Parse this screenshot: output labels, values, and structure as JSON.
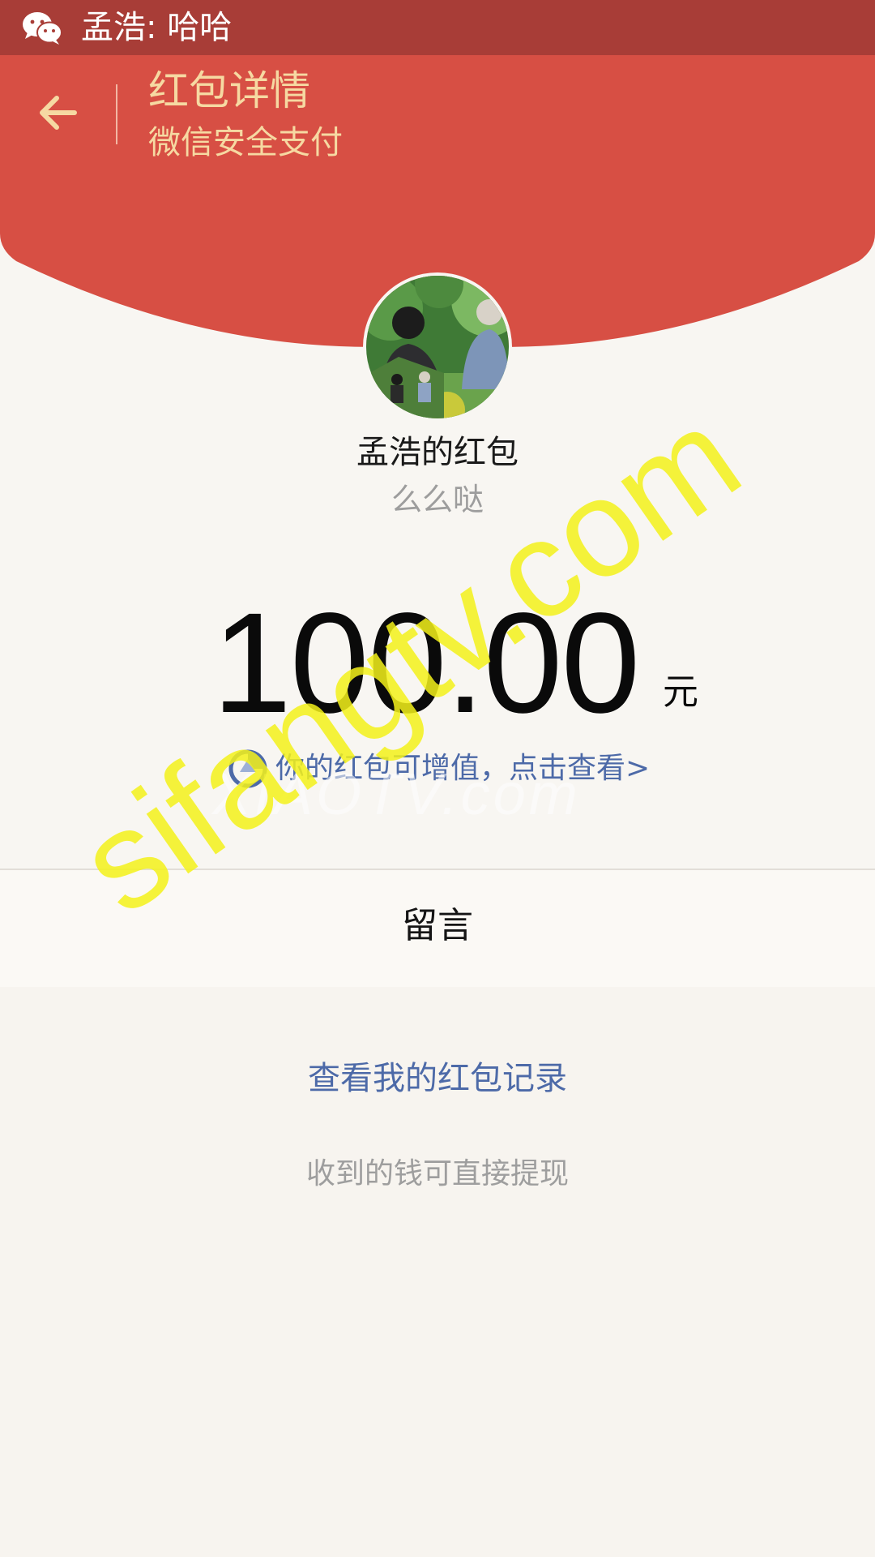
{
  "notification": {
    "text": "孟浩: 哈哈",
    "icon": "wechat-icon"
  },
  "header": {
    "title": "红包详情",
    "subtitle": "微信安全支付",
    "back_icon": "arrow-left-icon",
    "bg_color": "#d74f44",
    "accent_color": "#f6d9a2"
  },
  "sender": {
    "name": "孟浩的红包",
    "greeting": "么么哒"
  },
  "amount": {
    "value": "100.00",
    "unit": "元"
  },
  "promo": {
    "icon": "coin-badge-icon",
    "text": "你的红包可增值，点击查看>"
  },
  "message": {
    "label": "留言"
  },
  "footer": {
    "records_link": "查看我的红包记录",
    "withdraw_tip": "收到的钱可直接提现"
  },
  "watermarks": {
    "primary": "sifangtv.com",
    "secondary": "XIAOTV.com"
  }
}
